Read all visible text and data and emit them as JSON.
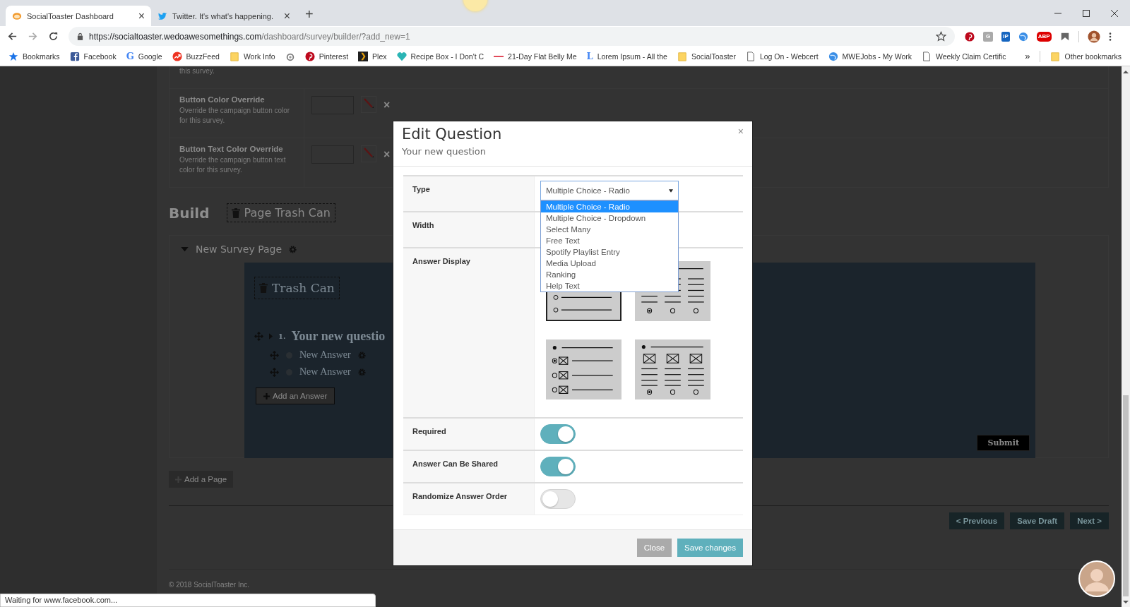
{
  "browser": {
    "tabs": [
      {
        "title": "SocialToaster Dashboard",
        "kind": "toast",
        "close": "×",
        "selected": true
      },
      {
        "title": "Twitter. It's what's happening.",
        "kind": "bird",
        "close": "×",
        "selected": false
      }
    ],
    "new_tab": "+",
    "url_host": "https://socialtoaster.wedoawesomethings.com",
    "url_path": "/dashboard/survey/builder/?add_new=1",
    "extensions": [
      {
        "kind": "pin"
      },
      {
        "kind": "gray-badge",
        "glyph": "G"
      },
      {
        "kind": "blue-badge",
        "glyph": "IP"
      },
      {
        "kind": "globe"
      },
      {
        "kind": "stop-badge",
        "glyph": "ABP"
      },
      {
        "kind": "flag"
      }
    ],
    "bookmarks": [
      {
        "label": "Bookmarks",
        "kind": "star"
      },
      {
        "label": "Facebook",
        "kind": "square"
      },
      {
        "label": "Google",
        "kind": "letter",
        "glyph": "G"
      },
      {
        "label": "BuzzFeed",
        "kind": "trend"
      },
      {
        "label": "Work Info",
        "kind": "folder"
      },
      {
        "kind": "ring"
      },
      {
        "label": "Pinterest",
        "kind": "pin"
      },
      {
        "label": "Plex",
        "kind": "chevron"
      },
      {
        "label": "Recipe Box - I Don't C",
        "kind": "heart"
      },
      {
        "label": "21-Day Flat Belly Me",
        "kind": "dash"
      },
      {
        "label": "Lorem Ipsum - All the",
        "kind": "letter",
        "glyph": "L"
      },
      {
        "label": "SocialToaster",
        "kind": "folder"
      },
      {
        "label": "Log On - Webcert",
        "kind": "page"
      },
      {
        "label": "MWEJobs - My Work",
        "kind": "globe"
      },
      {
        "label": "Weekly Claim Certific",
        "kind": "page"
      }
    ],
    "more": "»",
    "other_bookmarks": "Other bookmarks",
    "status": "Waiting for www.facebook.com..."
  },
  "page": {
    "cut_text": "this survey.",
    "settings": [
      {
        "label": "Button Color Override",
        "description": "Override the campaign button color for this survey.",
        "remove": "×"
      },
      {
        "label": "Button Text Color Override",
        "description": "Override the campaign button text color for this survey.",
        "remove": "×"
      }
    ],
    "build_title": "Build",
    "page_trash": "Page Trash Can",
    "survey_page": {
      "title": "New Survey Page",
      "expanded": true,
      "trash": "Trash Can",
      "question_number": "1.",
      "question": "Your new questio",
      "answers": [
        {
          "label": "New Answer",
          "selected": false
        },
        {
          "label": "New Answer",
          "selected": false
        }
      ],
      "add_answer": "Add an Answer",
      "submit": "Submit"
    },
    "add_page": "Add a Page",
    "nav_buttons": [
      "< Previous",
      "Save Draft",
      "Next >"
    ],
    "footer": "© 2018 SocialToaster Inc."
  },
  "modal": {
    "title": "Edit Question",
    "subtitle": "Your new question",
    "close": "×",
    "fields": [
      {
        "kind": "select",
        "label": "Type",
        "value": "Multiple Choice - Radio",
        "expanded": true,
        "options": [
          {
            "label": "Multiple Choice - Radio",
            "selected": true
          },
          {
            "label": "Multiple Choice - Dropdown",
            "selected": false
          },
          {
            "label": "Select Many",
            "selected": false
          },
          {
            "label": "Free Text",
            "selected": false
          },
          {
            "label": "Spotify Playlist Entry",
            "selected": false
          },
          {
            "label": "Media Upload",
            "selected": false
          },
          {
            "label": "Ranking",
            "selected": false
          },
          {
            "label": "Help Text",
            "selected": false
          }
        ]
      },
      {
        "kind": "blank",
        "label": "Width"
      },
      {
        "kind": "layouts",
        "label": "Answer Display",
        "options": [
          {
            "kind": "list",
            "selected": true
          },
          {
            "kind": "columns",
            "selected": false
          },
          {
            "kind": "image-list",
            "selected": false
          },
          {
            "kind": "image-columns",
            "selected": false
          }
        ]
      },
      {
        "kind": "toggle",
        "label": "Required",
        "on": true
      },
      {
        "kind": "toggle",
        "label": "Answer Can Be Shared",
        "on": true
      },
      {
        "kind": "toggle",
        "label": "Randomize Answer Order",
        "on": false
      }
    ],
    "buttons": [
      {
        "label": "Close",
        "kind": "secondary"
      },
      {
        "label": "Save changes",
        "kind": "primary"
      }
    ]
  }
}
